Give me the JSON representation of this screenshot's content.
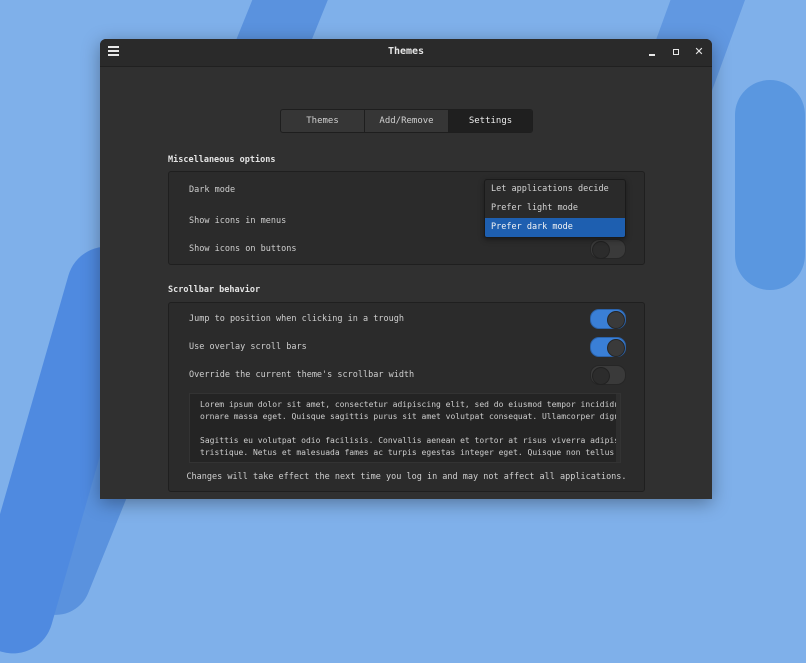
{
  "window": {
    "title": "Themes"
  },
  "tabs": [
    {
      "label": "Themes",
      "active": false
    },
    {
      "label": "Add/Remove",
      "active": false
    },
    {
      "label": "Settings",
      "active": true
    }
  ],
  "misc": {
    "title": "Miscellaneous options",
    "dark_mode_label": "Dark mode",
    "icons_menus_label": "Show icons in menus",
    "icons_buttons_label": "Show icons on buttons",
    "icons_buttons_on": false,
    "dark_mode_options": [
      {
        "label": "Let applications decide",
        "selected": false
      },
      {
        "label": "Prefer light mode",
        "selected": false
      },
      {
        "label": "Prefer dark mode",
        "selected": true
      }
    ]
  },
  "scrollbar": {
    "title": "Scrollbar behavior",
    "jump_label": "Jump to position when clicking in a trough",
    "jump_on": true,
    "overlay_label": "Use overlay scroll bars",
    "overlay_on": true,
    "override_label": "Override the current theme's scrollbar width",
    "override_on": false,
    "preview_text": [
      "Lorem ipsum dolor sit amet, consectetur adipiscing elit, sed do eiusmod tempor incididun",
      "ornare massa eget. Quisque sagittis purus sit amet volutpat consequat. Ullamcorper dign",
      "Sagittis eu volutpat odio facilisis. Convallis aenean et tortor at risus viverra adipis",
      "tristique. Netus et malesuada fames ac turpis egestas integer eget. Quisque non tellus o"
    ],
    "notice": "Changes will take effect the next time you log in and may not affect all applications."
  },
  "colors": {
    "accent": "#3a7fd6",
    "selected": "#1e5fb0"
  }
}
